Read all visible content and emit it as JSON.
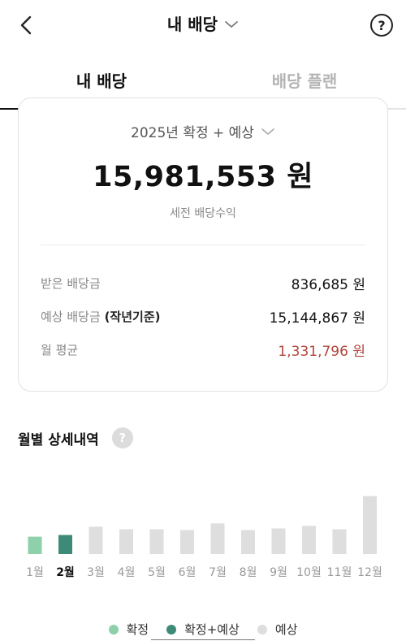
{
  "header": {
    "title": "내 배당",
    "back_icon": "chevron-left-icon",
    "help_label": "?"
  },
  "tabs": [
    {
      "label": "내 배당",
      "active": true
    },
    {
      "label": "배당 플랜",
      "active": false
    }
  ],
  "summary": {
    "period": "2025년 확정 + 예상",
    "total": "15,981,553 원",
    "total_caption": "세전 배당수익",
    "rows": [
      {
        "label": "받은 배당금",
        "label_em": "",
        "value": "836,685 원"
      },
      {
        "label": "예상 배당금",
        "label_em": "(작년기준)",
        "value": "15,144,867 원"
      },
      {
        "label": "월 평균",
        "label_em": "",
        "value": "1,331,796 원"
      }
    ]
  },
  "monthly": {
    "title": "월별 상세내역",
    "help_label": "?"
  },
  "chart_data": {
    "type": "bar",
    "categories": [
      "1월",
      "2월",
      "3월",
      "4월",
      "5월",
      "6월",
      "7월",
      "8월",
      "9월",
      "10월",
      "11월",
      "12월"
    ],
    "values": [
      0.21,
      0.23,
      0.33,
      0.3,
      0.3,
      0.29,
      0.37,
      0.29,
      0.31,
      0.34,
      0.3,
      0.7
    ],
    "status": [
      "확정",
      "확정+예상",
      "예상",
      "예상",
      "예상",
      "예상",
      "예상",
      "예상",
      "예상",
      "예상",
      "예상",
      "예상"
    ],
    "selected": "2월",
    "value_scale": "relative (no axis printed)",
    "colors": {
      "확정": "#8dd0aa",
      "확정+예상": "#3e8a78",
      "예상": "#dedede"
    }
  },
  "legend": [
    {
      "label": "확정",
      "color": "#8dd0aa"
    },
    {
      "label": "확정+예상",
      "color": "#3e8a78"
    },
    {
      "label": "예상",
      "color": "#dedede"
    }
  ]
}
